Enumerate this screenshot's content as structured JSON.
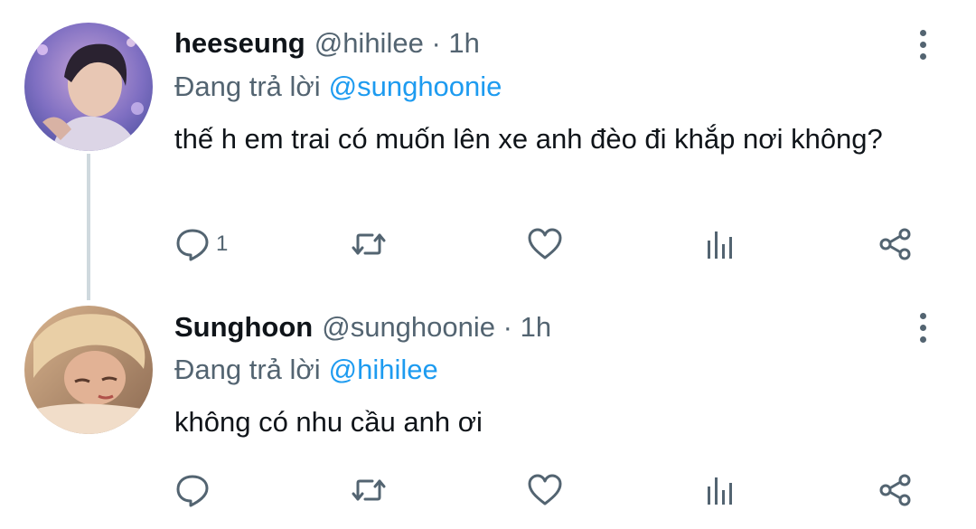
{
  "tweets": [
    {
      "name": "heeseung",
      "handle": "@hihilee",
      "time": "1h",
      "separator": "·",
      "reply_prefix": "Đang trả lời",
      "reply_handle": "@sunghoonie",
      "text": "thế h em trai có muốn lên xe anh đèo đi khắp nơi không?",
      "reply_count": "1",
      "icons": [
        "reply-icon",
        "retweet-icon",
        "like-icon",
        "analytics-icon",
        "share-icon"
      ]
    },
    {
      "name": "Sunghoon",
      "handle": "@sunghoonie",
      "time": "1h",
      "separator": "·",
      "reply_prefix": "Đang trả lời",
      "reply_handle": "@hihilee",
      "text": "không có nhu cầu anh ơi",
      "reply_count": "",
      "icons": [
        "reply-icon",
        "retweet-icon",
        "like-icon",
        "analytics-icon",
        "share-icon"
      ]
    }
  ],
  "colors": {
    "link": "#1d9bf0",
    "secondary": "#536471",
    "thread_line": "#cfd9de"
  }
}
